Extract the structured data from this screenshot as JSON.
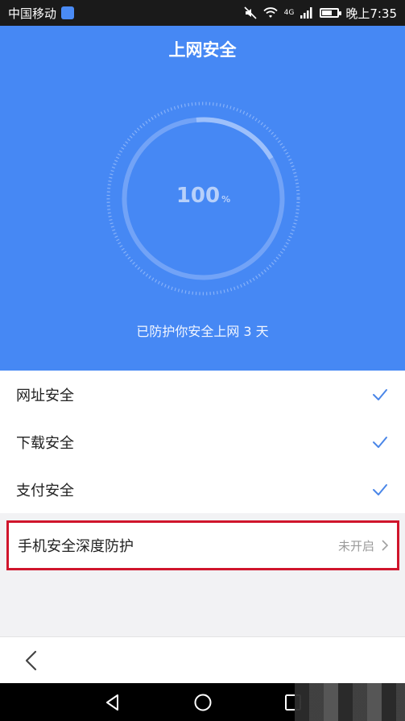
{
  "status_bar": {
    "carrier": "中国移动",
    "network": "4G",
    "time": "晚上7:35",
    "battery_level": 0.65
  },
  "header": {
    "title": "上网安全",
    "score": "100",
    "score_unit": "%",
    "protect_text": "已防护你安全上网 3 天"
  },
  "security_items": [
    {
      "label": "网址安全",
      "checked": true
    },
    {
      "label": "下载安全",
      "checked": true
    },
    {
      "label": "支付安全",
      "checked": true
    }
  ],
  "deep_protection": {
    "label": "手机安全深度防护",
    "status": "未开启"
  },
  "icons": {
    "back": "back-arrow-icon",
    "check": "checkmark-icon",
    "chevron": "chevron-right-icon"
  },
  "colors": {
    "header_blue": "#4688f4",
    "highlight_red": "#d0152c",
    "check_blue": "#4a86e8"
  }
}
